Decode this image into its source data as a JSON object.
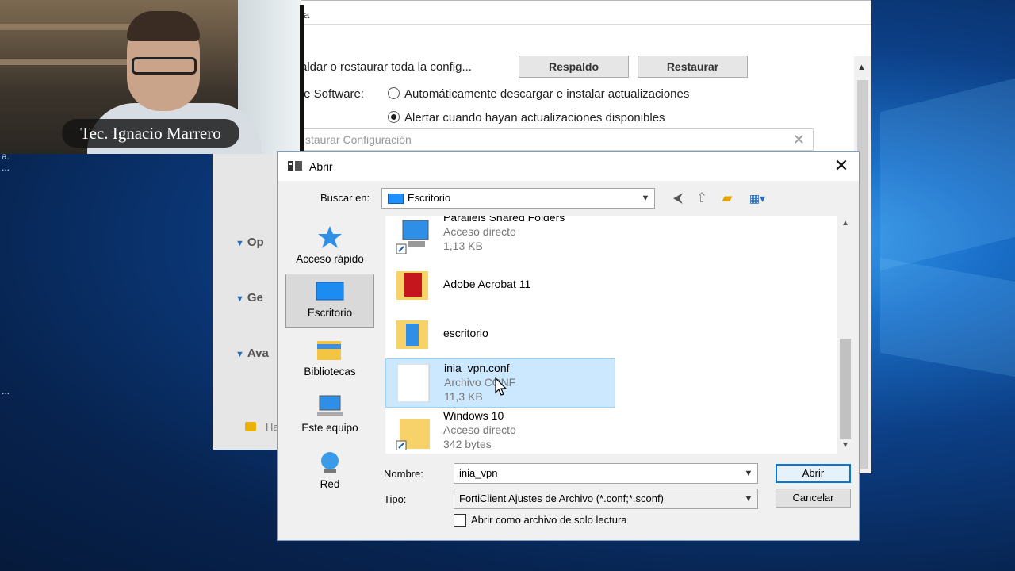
{
  "webcam": {
    "caption": "Tec. Ignacio Marrero"
  },
  "background_window": {
    "top_fragment": "a",
    "backup_row_label": "aldar o restaurar toda la config...",
    "backup_button": "Respaldo",
    "restore_button": "Restaurar",
    "software_label": "te Software:",
    "radio_auto": "Automáticamente descargar e instalar actualizaciones",
    "radio_alert": "Alertar cuando hayan actualizaciones disponibles",
    "restore_bar_title": "staurar Configuración",
    "sections": [
      "Op",
      "Ge",
      "Ava"
    ],
    "lock_text": "Ha"
  },
  "side_text": {
    "a": "a.",
    "dots": "..."
  },
  "dialog": {
    "title": "Abrir",
    "look_in_label": "Buscar en:",
    "look_in_value": "Escritorio",
    "places": [
      {
        "label": "Acceso rápido"
      },
      {
        "label": "Escritorio"
      },
      {
        "label": "Bibliotecas"
      },
      {
        "label": "Este equipo"
      },
      {
        "label": "Red"
      }
    ],
    "files": [
      {
        "name": "Parallels Shared Folders",
        "type": "Acceso directo",
        "size": "1,13 KB"
      },
      {
        "name": "Adobe Acrobat 11",
        "type": "",
        "size": ""
      },
      {
        "name": "escritorio",
        "type": "",
        "size": ""
      },
      {
        "name": "inia_vpn.conf",
        "type": "Archivo CONF",
        "size": "11,3 KB"
      },
      {
        "name": "Windows 10",
        "type": "Acceso directo",
        "size": "342 bytes"
      }
    ],
    "filename_label": "Nombre:",
    "filename_value": "inia_vpn",
    "filetype_label": "Tipo:",
    "filetype_value": "FortiClient Ajustes de Archivo (*.conf;*.sconf)",
    "open_button": "Abrir",
    "cancel_button": "Cancelar",
    "readonly_label": "Abrir como archivo de solo lectura"
  }
}
